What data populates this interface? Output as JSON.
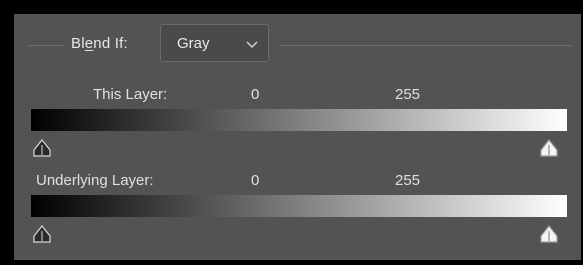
{
  "blend_if": {
    "label_prefix": "Bl",
    "label_mnemonic": "e",
    "label_suffix": "nd If:",
    "channel": {
      "selected": "Gray",
      "icon": "chevron-down-icon"
    }
  },
  "this_layer": {
    "label": "This Layer:",
    "min_value": "0",
    "max_value": "255",
    "black_point": 0,
    "white_point": 255,
    "gradient_start": "#000000",
    "gradient_end": "#ffffff"
  },
  "underlying_layer": {
    "label": "Underlying Layer:",
    "min_value": "0",
    "max_value": "255",
    "black_point": 0,
    "white_point": 255,
    "gradient_start": "#000000",
    "gradient_end": "#ffffff"
  },
  "colors": {
    "panel_bg": "#535353",
    "frame": "#000000",
    "text": "#e0e0e0",
    "dropdown_bg": "#4a4a4a",
    "black_handle": "#2a2a2a",
    "white_handle": "#f4f4f4"
  }
}
